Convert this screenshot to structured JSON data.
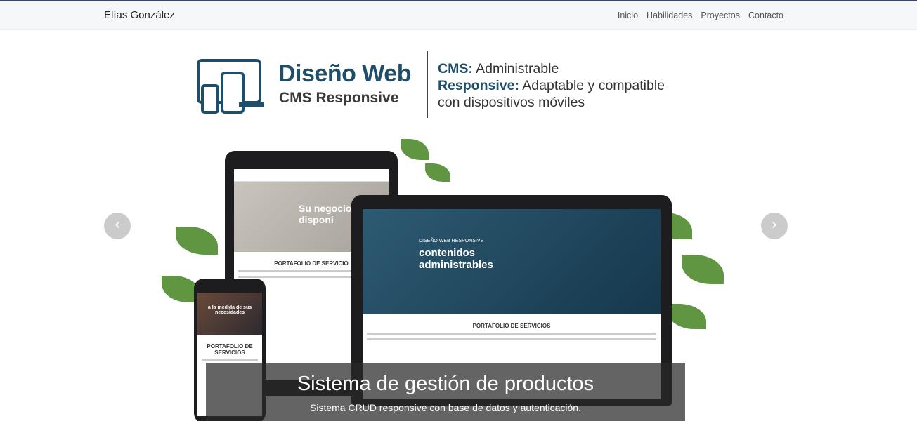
{
  "navbar": {
    "brand": "Elías González",
    "links": [
      "Inicio",
      "Habilidades",
      "Proyectos",
      "Contacto"
    ]
  },
  "banner": {
    "logo_main": "Diseño Web",
    "logo_sub": "CMS Responsive",
    "tag_cms_label": "CMS:",
    "tag_cms_text": "Administrable",
    "tag_resp_label": "Responsive:",
    "tag_resp_text": "Adaptable y compatible",
    "tag_line3": "con dispositivos móviles"
  },
  "screens": {
    "tablet_hero": "Su negocio disponi",
    "tablet_section": "PORTAFOLIO DE SERVICIO",
    "laptop_kicker": "DISEÑO WEB RESPONSIVE",
    "laptop_hero": "contenidos administrables",
    "laptop_section": "PORTAFOLIO DE SERVICIOS",
    "phone_hero": "a la medida de sus necesidades",
    "phone_section": "PORTAFOLIO DE SERVICIOS"
  },
  "carousel": {
    "prev": "‹",
    "next": "›",
    "caption_title": "Sistema de gestión de productos",
    "caption_text": "Sistema CRUD responsive con base de datos y autenticación."
  },
  "colors": {
    "brand_blue": "#1f4e6a",
    "nav_bg": "#f6f7f9"
  }
}
